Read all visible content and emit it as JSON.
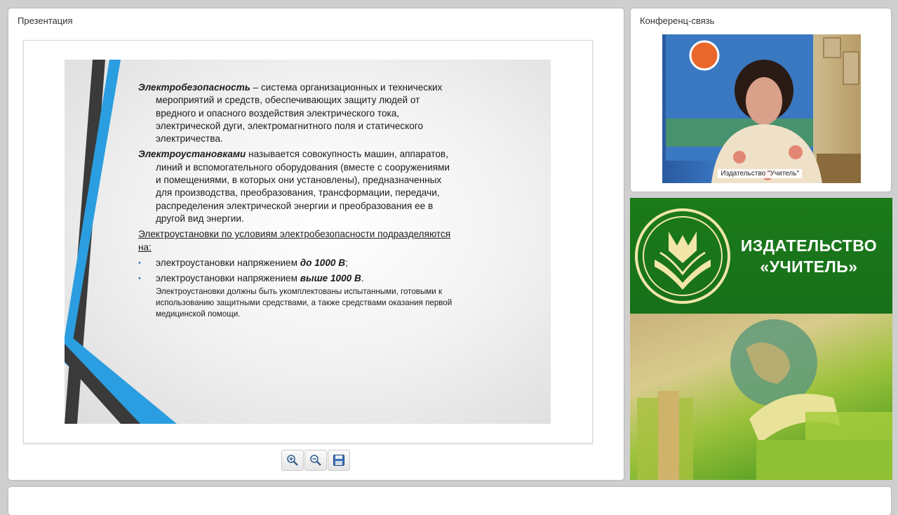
{
  "presentation": {
    "title": "Презентация",
    "slide": {
      "p1_term": "Электробезопасность",
      "p1_text": " – система организационных и технических мероприятий и средств, обеспечивающих защиту людей от вредного и опасного воздействия электрического тока, электрической дуги, электромагнитного поля и статического электричества.",
      "p2_term": "Электроустановками",
      "p2_text": " называется совокупность машин, аппаратов, линий и вспомогательного оборудования (вместе с сооружениями и помещениями, в которых они установлены), предназначенных для производства, преобразования, трансформации, передачи, распределения электрической энергии и преобразования ее в другой вид энергии.",
      "p3": "Электроустановки по условиям электробезопасности подразделяются на:",
      "bullet_char": "•",
      "b1_pre": "электроустановки напряжением ",
      "b1_bold": "до 1000 В",
      "b1_post": ";",
      "b2_pre": "электроустановки напряжением ",
      "b2_bold": "выше 1000 В",
      "b2_post": ".",
      "note": "Электроустановки должны быть укомплектованы испытанными, готовыми к использованию защитными средствами, а также средствами оказания первой медицинской помощи."
    }
  },
  "toolbar": {
    "zoom_in_icon": "zoom-in-icon",
    "zoom_out_icon": "zoom-out-icon",
    "save_icon": "save-icon"
  },
  "conference": {
    "title": "Конференц-связь",
    "video_label": "Издательство \"Учитель\""
  },
  "brand": {
    "name_line1": "ИЗДАТЕЛЬСТВО",
    "name_line2": "«УЧИТЕЛЬ»"
  },
  "colors": {
    "slide_accent_blue": "#2a9ee0",
    "slide_accent_dark": "#3a3a3a",
    "brand_green": "#1c7a1a"
  }
}
